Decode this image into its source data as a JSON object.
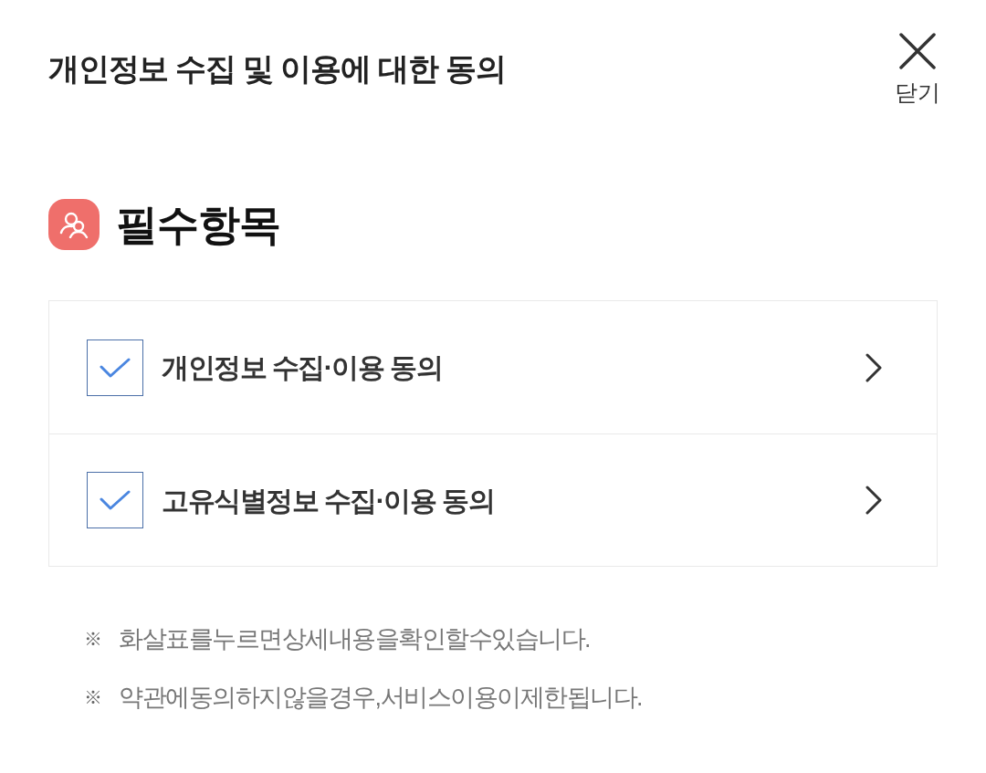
{
  "header": {
    "title": "개인정보 수집 및 이용에 대한 동의",
    "close_label": "닫기"
  },
  "section": {
    "title": "필수항목"
  },
  "agreements": [
    {
      "label": "개인정보 수집·이용 동의",
      "checked": true
    },
    {
      "label": "고유식별정보 수집·이용 동의",
      "checked": true
    }
  ],
  "notes": [
    {
      "mark": "※",
      "text": "화살표를누르면상세내용을확인할수있습니다."
    },
    {
      "mark": "※",
      "text": "약관에동의하지않을경우,서비스이용이제한됩니다."
    }
  ]
}
